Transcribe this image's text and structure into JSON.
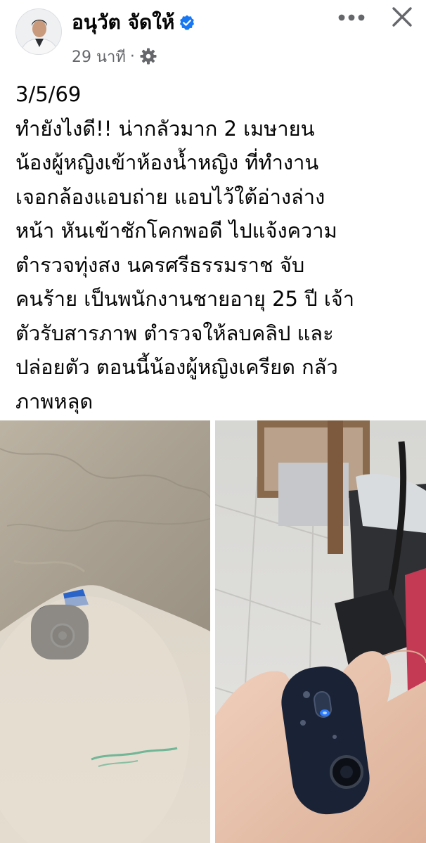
{
  "header": {
    "author_name": "อนุวัต จัดให้",
    "time_ago": "29 นาที",
    "separator": "·",
    "verified_icon": "verified-badge-icon",
    "audience_icon": "gear-icon",
    "more_icon": "more-horizontal-icon",
    "close_icon": "close-icon"
  },
  "post": {
    "lines": [
      "3/5/69",
      "ทำยังไงดี!! น่ากลัวมาก  2 เมษายน",
      "น้องผู้หญิงเข้าห้องน้ำหญิง ที่ทำงาน",
      "เจอกล้องแอบถ่าย แอบไว้ใต้อ่างล่าง",
      "หน้า หันเข้าชักโคกพอดี ไปแจ้งความ",
      "ตำรวจทุ่งสง นครศรีธรรมราช จับ",
      "คนร้าย เป็นพนักงานชายอายุ 25 ปี เจ้า",
      "ตัวรับสารภาพ ตำรวจให้ลบคลิป  และ",
      "ปล่อยตัว  ตอนนี้น้องผู้หญิงเครียด กลัว",
      "ภาพหลุด"
    ]
  },
  "colors": {
    "text": "#050505",
    "meta": "#65676b",
    "verified": "#1877f2",
    "icon": "#65676b"
  }
}
